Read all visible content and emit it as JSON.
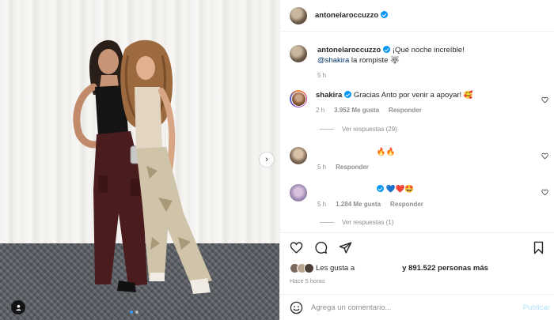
{
  "post": {
    "author": "antonelaroccuzzo",
    "image_alt": "",
    "carousel_dots": 2,
    "active_dot": 1
  },
  "header": {
    "username": "antonelaroccuzzo",
    "menu_icon": "more-horizontal-icon"
  },
  "caption": {
    "username": "antonelaroccuzzo",
    "text": "¡Qué noche increíble!",
    "mention": "@shakira",
    "text2": " la rompiste 🐺",
    "time": "5 h"
  },
  "comments": [
    {
      "username": "shakira",
      "text": "Gracias Anto por venir a apoyar! 🥰",
      "time": "2 h",
      "likes": "3.952 Me gusta",
      "reply": "Responder",
      "view_replies": "Ver respuestas (29)"
    },
    {
      "username": "",
      "text": "🔥🔥",
      "time": "5 h",
      "reply": "Responder"
    },
    {
      "username": "",
      "text": "💙❤️🤩",
      "time": "5 h",
      "likes": "1.284 Me gusta",
      "reply": "Responder",
      "view_replies": "Ver respuestas (1)"
    }
  ],
  "actions": {
    "liked_by_prefix": "Les gusta a",
    "liked_by_suffix": "y 891.522 personas más",
    "timestamp": "Hace 5 horas"
  },
  "comment_input": {
    "placeholder": "Agrega un comentario...",
    "publish_label": "Publicar"
  },
  "colors": {
    "accent": "#0095f6",
    "text": "#262626",
    "muted": "#8e8e8e",
    "link": "#00376b"
  }
}
